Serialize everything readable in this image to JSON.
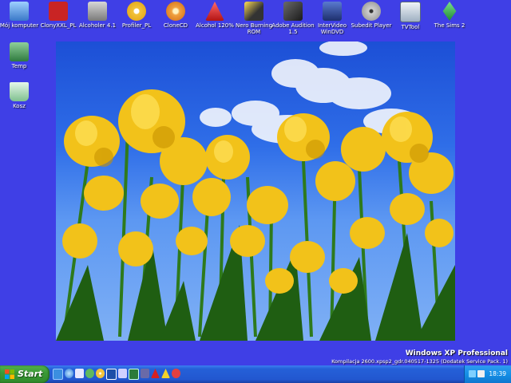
{
  "desktop_icons": [
    {
      "label": "Mój komputer",
      "icon": "computer-icon",
      "color": "#6aa8e8"
    },
    {
      "label": "ClonyXXL_PL",
      "icon": "clonyxxl-icon",
      "color": "#c92424"
    },
    {
      "label": "Alcoholer 4.1",
      "icon": "alcoholer-icon",
      "color": "#9a9a9a"
    },
    {
      "label": "Profiler_PL",
      "icon": "cd-icon",
      "color": "#f2c23a"
    },
    {
      "label": "CloneCD",
      "icon": "clonecd-icon",
      "color": "#e98b2f"
    },
    {
      "label": "Alcohol 120%",
      "icon": "alcohol-icon",
      "color": "#d62020"
    },
    {
      "label": "Nero Burning\nROM",
      "icon": "nero-icon",
      "color": "#333333"
    },
    {
      "label": "Adobe Audition\n1.5",
      "icon": "audition-icon",
      "color": "#2b2b2b"
    },
    {
      "label": "InterVideo\nWinDVD",
      "icon": "windvd-icon",
      "color": "#1d2f6e"
    },
    {
      "label": "Subedit Player",
      "icon": "film-reel-icon",
      "color": "#cfcfcf"
    },
    {
      "label": "TVTool",
      "icon": "tv-icon",
      "color": "#d8e2ec"
    },
    {
      "label": "The Sims 2",
      "icon": "sims-icon",
      "color": "#34b04a"
    },
    {
      "label": "Temp",
      "icon": "folder-icon",
      "color": "#4a9a5a"
    },
    {
      "label": "Kosz",
      "icon": "recycle-bin-icon",
      "color": "#bfe1c6"
    }
  ],
  "branding": {
    "product": "Windows XP Professional",
    "build": "Kompilacja 2600.xpsp2_gdr.040517-1325 (Dodatek Service Pack. 1)"
  },
  "taskbar": {
    "start_label": "Start",
    "quick_launch": [
      {
        "icon": "show-desktop-icon",
        "color": "#3b8ee0"
      },
      {
        "icon": "ie-icon",
        "color": "#4aa6ff"
      },
      {
        "icon": "media-player-icon",
        "color": "#e8e8ff"
      },
      {
        "icon": "messenger-icon",
        "color": "#5fb85f"
      },
      {
        "icon": "cd-icon",
        "color": "#f4c43a"
      },
      {
        "icon": "window-icon",
        "color": "#1d4fa8"
      },
      {
        "icon": "app-icon",
        "color": "#d0d0ff"
      },
      {
        "icon": "screen-icon",
        "color": "#2b7a3a"
      },
      {
        "icon": "monitor-icon",
        "color": "#6a6aa8"
      },
      {
        "icon": "alcohol-icon",
        "color": "#d62020"
      },
      {
        "icon": "warning-icon",
        "color": "#f3d22a"
      },
      {
        "icon": "tool-icon",
        "color": "#e34040"
      }
    ],
    "tray": {
      "clock": "18:39"
    }
  }
}
